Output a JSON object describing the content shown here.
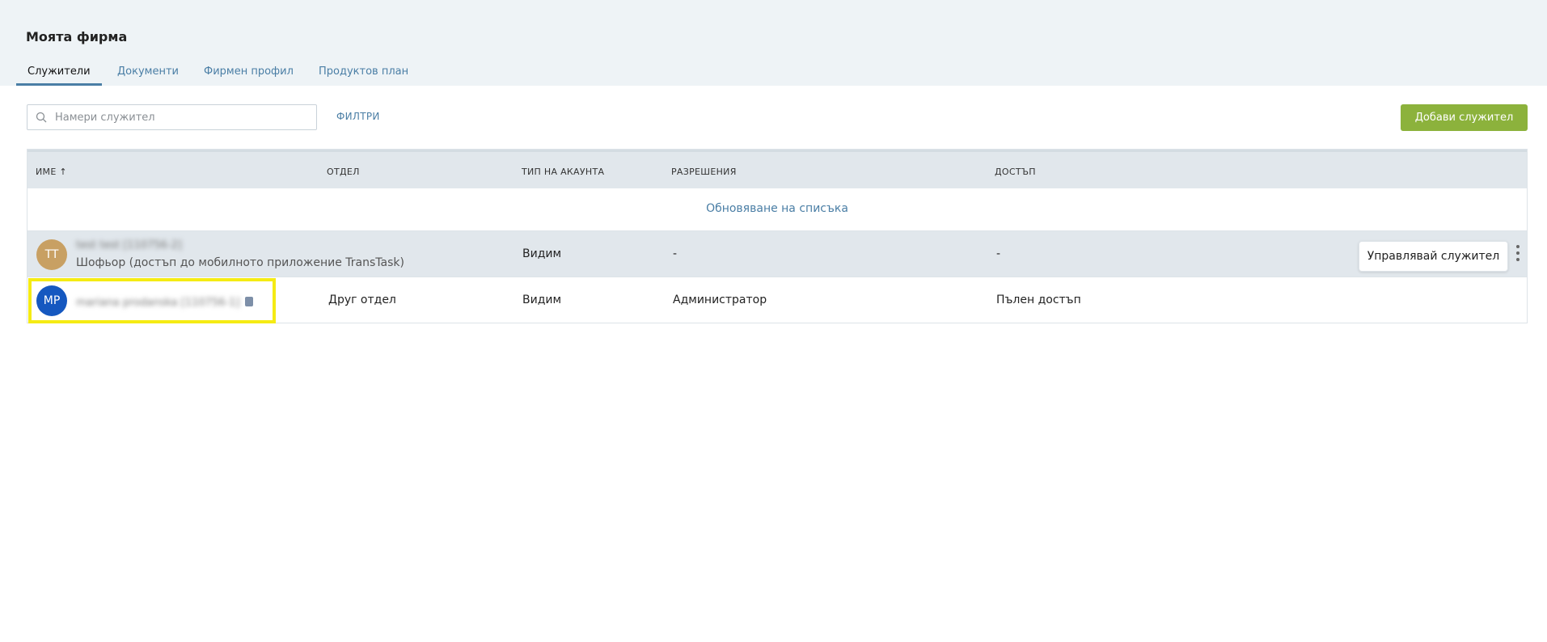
{
  "header": {
    "title": "Моята фирма",
    "tabs": [
      {
        "label": "Служители",
        "active": true
      },
      {
        "label": "Документи",
        "active": false
      },
      {
        "label": "Фирмен профил",
        "active": false
      },
      {
        "label": "Продуктов план",
        "active": false
      }
    ]
  },
  "toolbar": {
    "search_placeholder": "Намери служител",
    "search_value": "",
    "filters_label": "ФИЛТРИ",
    "add_button_label": "Добави служител"
  },
  "table": {
    "columns": [
      "ИМЕ ↑",
      "ОТДЕЛ",
      "ТИП НА АКАУНТА",
      "РАЗРЕШЕНИЯ",
      "ДОСТЪП"
    ],
    "refresh_label": "Обновяване на списъка",
    "rows": [
      {
        "initials": "TT",
        "avatar_color": "#c8a063",
        "name": "test test [110756-2]",
        "subtitle": "Шофьор (достъп до мобилното приложение TransTask)",
        "department": "",
        "account_type": "Видим",
        "permissions": "-",
        "access": "-",
        "manage_label": "Управлявай служител"
      },
      {
        "initials": "MP",
        "avatar_color": "#1558c0",
        "name": "mariana prodanska [110756-1]",
        "subtitle": "",
        "department": "Друг отдел",
        "account_type": "Видим",
        "permissions": "Администратор",
        "access": "Пълен достъп"
      }
    ]
  },
  "colors": {
    "accent": "#4a7ea5",
    "add_button": "#8cb23c",
    "highlight": "#f5eb14"
  }
}
